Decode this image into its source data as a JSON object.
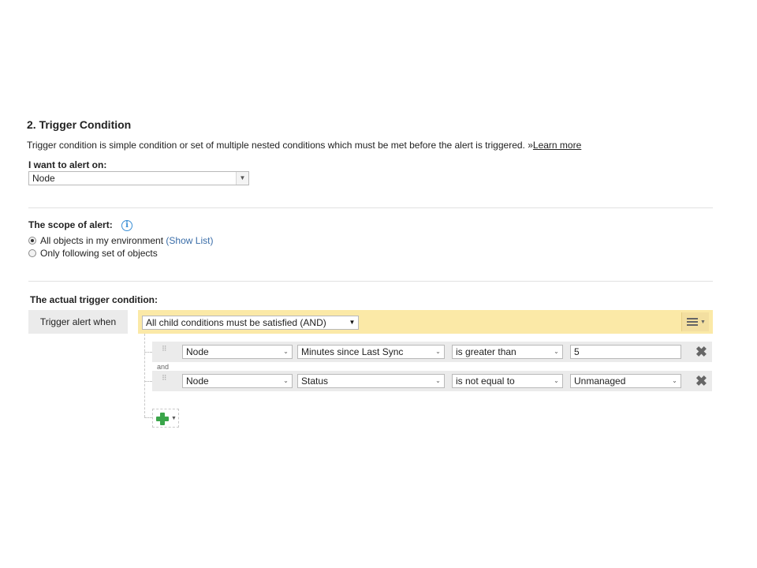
{
  "section": {
    "title": "2. Trigger Condition",
    "description": "Trigger condition is simple condition or set of multiple nested conditions which must be met before the alert is triggered.",
    "learn_more_prefix": "»",
    "learn_more": "Learn more"
  },
  "alert_on": {
    "label": "I want to alert on:",
    "selected": "Node"
  },
  "scope": {
    "label": "The scope of alert:",
    "info_icon": "info-icon",
    "options": [
      {
        "label": "All objects in my environment",
        "link": "(Show List)",
        "selected": true
      },
      {
        "label": "Only following set of objects",
        "selected": false
      }
    ]
  },
  "trigger": {
    "label": "The actual trigger condition:",
    "when_label": "Trigger alert when",
    "logic_selected": "All child conditions must be satisfied (AND)",
    "and_label": "and",
    "conditions": [
      {
        "object": "Node",
        "property": "Minutes since Last Sync",
        "operator": "is greater than",
        "value": "5"
      },
      {
        "object": "Node",
        "property": "Status",
        "operator": "is not equal to",
        "value": "Unmanaged"
      }
    ]
  },
  "colors": {
    "yellow_bar": "#fbe9a7",
    "row_bg": "#ebebeb",
    "link": "#3a6da8",
    "add_green": "#3aa54a"
  }
}
